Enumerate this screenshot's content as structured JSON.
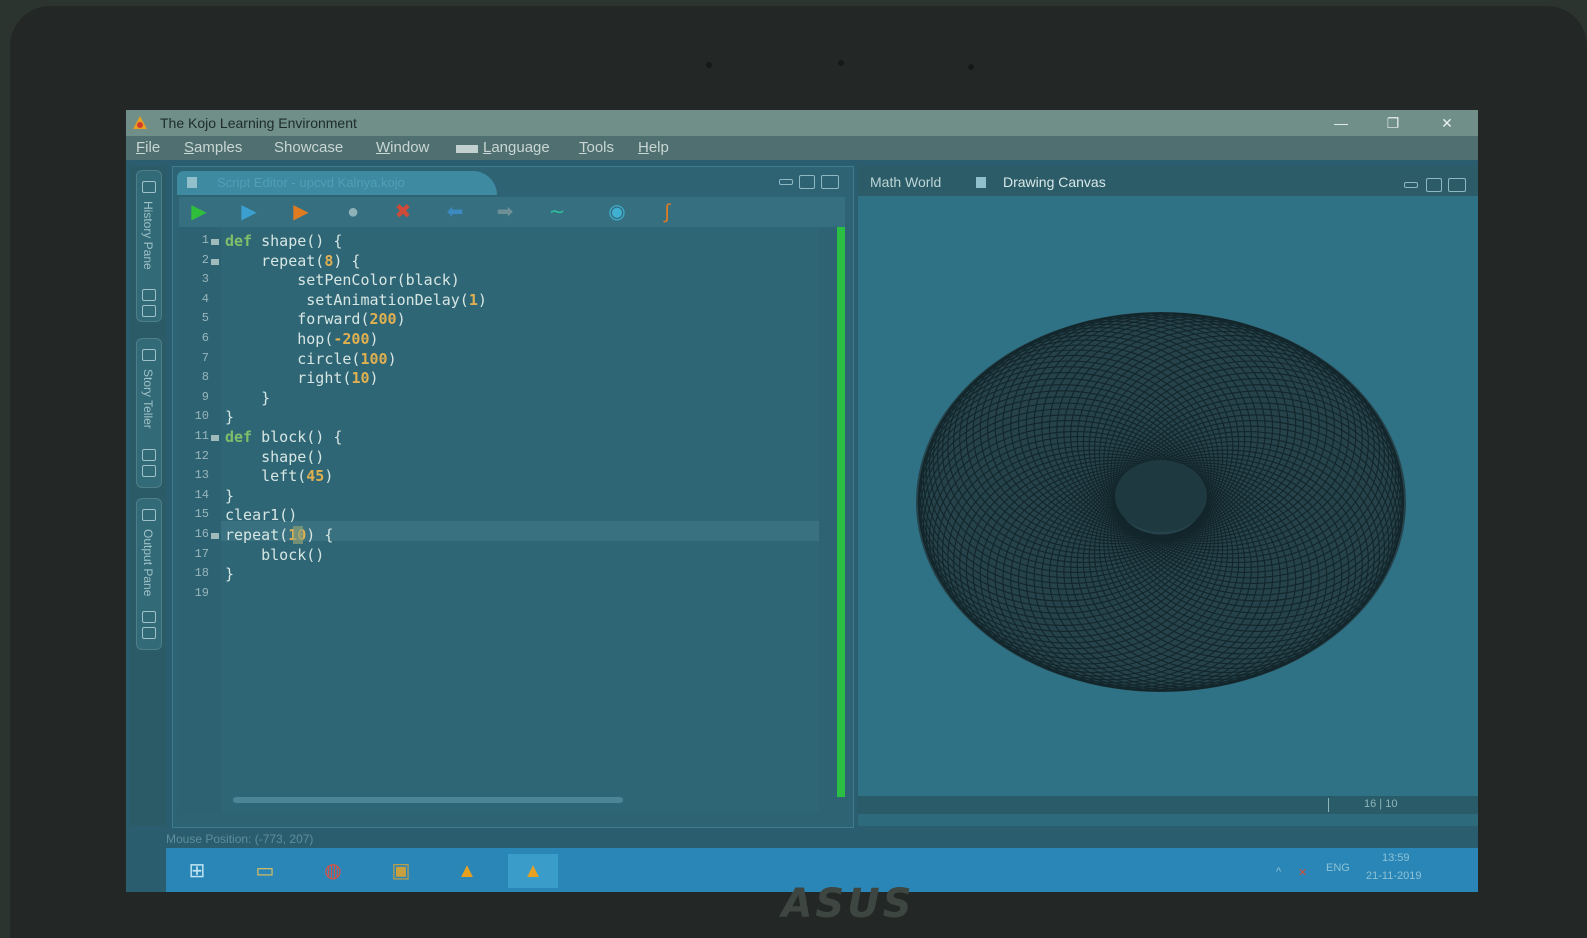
{
  "window": {
    "title": "The Kojo Learning Environment",
    "controls": {
      "minimize": "—",
      "restore": "❐",
      "close": "✕"
    }
  },
  "menu": [
    "File",
    "Samples",
    "Showcase",
    "Window",
    "Language",
    "Tools",
    "Help"
  ],
  "side_panes": [
    "History Pane",
    "Story Teller",
    "Output Pane"
  ],
  "editor": {
    "tab_label": "Script Editor - upcvd Kalnya.kojo",
    "toolbar_icons": [
      "run-icon",
      "run-worksheet-icon",
      "trace-icon",
      "stop-icon",
      "clear-icon",
      "undo-icon",
      "redo-icon",
      "format-icon",
      "check-icon",
      "erase-icon"
    ],
    "lines": [
      "def shape() {",
      "    repeat(8) {",
      "        setPenColor(black)",
      "         setAnimationDelay(1)",
      "        forward(200)",
      "        hop(-200)",
      "        circle(100)",
      "        right(10)",
      "    }",
      "}",
      "def block() {",
      "    shape()",
      "    left(45)",
      "}",
      "clear1()",
      "repeat(10) {",
      "    block()",
      "}",
      ""
    ],
    "line_numbers": [
      "1",
      "2",
      "3",
      "4",
      "5",
      "6",
      "7",
      "8",
      "9",
      "10",
      "11",
      "12",
      "13",
      "14",
      "15",
      "16",
      "17",
      "18",
      "19"
    ]
  },
  "canvas": {
    "tabs": [
      "Math World",
      "Drawing Canvas"
    ],
    "active_tab": "Drawing Canvas",
    "position_readout": "16 | 10"
  },
  "status": {
    "mouse_position": "Mouse Position: (-773, 207)"
  },
  "taskbar": {
    "apps": [
      "windows-start-icon",
      "file-explorer-icon",
      "chrome-icon",
      "media-player-icon",
      "kojo-icon",
      "kojo-icon"
    ],
    "language": "ENG",
    "time": "13:59",
    "date": "21-11-2019"
  },
  "device": {
    "brand": "ASUS"
  },
  "colors": {
    "keyword": "#7fbf6a",
    "number": "#e0b050",
    "run_green": "#2fbf3c",
    "run_orange": "#e07b22"
  }
}
